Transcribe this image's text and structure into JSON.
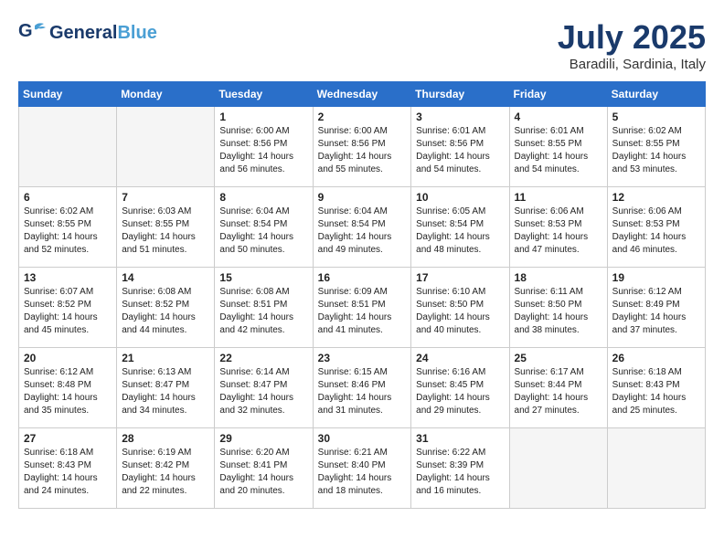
{
  "header": {
    "logo_general": "General",
    "logo_blue": "Blue",
    "month_year": "July 2025",
    "location": "Baradili, Sardinia, Italy"
  },
  "days_of_week": [
    "Sunday",
    "Monday",
    "Tuesday",
    "Wednesday",
    "Thursday",
    "Friday",
    "Saturday"
  ],
  "weeks": [
    [
      {
        "day": "",
        "info": ""
      },
      {
        "day": "",
        "info": ""
      },
      {
        "day": "1",
        "info": "Sunrise: 6:00 AM\nSunset: 8:56 PM\nDaylight: 14 hours\nand 56 minutes."
      },
      {
        "day": "2",
        "info": "Sunrise: 6:00 AM\nSunset: 8:56 PM\nDaylight: 14 hours\nand 55 minutes."
      },
      {
        "day": "3",
        "info": "Sunrise: 6:01 AM\nSunset: 8:56 PM\nDaylight: 14 hours\nand 54 minutes."
      },
      {
        "day": "4",
        "info": "Sunrise: 6:01 AM\nSunset: 8:55 PM\nDaylight: 14 hours\nand 54 minutes."
      },
      {
        "day": "5",
        "info": "Sunrise: 6:02 AM\nSunset: 8:55 PM\nDaylight: 14 hours\nand 53 minutes."
      }
    ],
    [
      {
        "day": "6",
        "info": "Sunrise: 6:02 AM\nSunset: 8:55 PM\nDaylight: 14 hours\nand 52 minutes."
      },
      {
        "day": "7",
        "info": "Sunrise: 6:03 AM\nSunset: 8:55 PM\nDaylight: 14 hours\nand 51 minutes."
      },
      {
        "day": "8",
        "info": "Sunrise: 6:04 AM\nSunset: 8:54 PM\nDaylight: 14 hours\nand 50 minutes."
      },
      {
        "day": "9",
        "info": "Sunrise: 6:04 AM\nSunset: 8:54 PM\nDaylight: 14 hours\nand 49 minutes."
      },
      {
        "day": "10",
        "info": "Sunrise: 6:05 AM\nSunset: 8:54 PM\nDaylight: 14 hours\nand 48 minutes."
      },
      {
        "day": "11",
        "info": "Sunrise: 6:06 AM\nSunset: 8:53 PM\nDaylight: 14 hours\nand 47 minutes."
      },
      {
        "day": "12",
        "info": "Sunrise: 6:06 AM\nSunset: 8:53 PM\nDaylight: 14 hours\nand 46 minutes."
      }
    ],
    [
      {
        "day": "13",
        "info": "Sunrise: 6:07 AM\nSunset: 8:52 PM\nDaylight: 14 hours\nand 45 minutes."
      },
      {
        "day": "14",
        "info": "Sunrise: 6:08 AM\nSunset: 8:52 PM\nDaylight: 14 hours\nand 44 minutes."
      },
      {
        "day": "15",
        "info": "Sunrise: 6:08 AM\nSunset: 8:51 PM\nDaylight: 14 hours\nand 42 minutes."
      },
      {
        "day": "16",
        "info": "Sunrise: 6:09 AM\nSunset: 8:51 PM\nDaylight: 14 hours\nand 41 minutes."
      },
      {
        "day": "17",
        "info": "Sunrise: 6:10 AM\nSunset: 8:50 PM\nDaylight: 14 hours\nand 40 minutes."
      },
      {
        "day": "18",
        "info": "Sunrise: 6:11 AM\nSunset: 8:50 PM\nDaylight: 14 hours\nand 38 minutes."
      },
      {
        "day": "19",
        "info": "Sunrise: 6:12 AM\nSunset: 8:49 PM\nDaylight: 14 hours\nand 37 minutes."
      }
    ],
    [
      {
        "day": "20",
        "info": "Sunrise: 6:12 AM\nSunset: 8:48 PM\nDaylight: 14 hours\nand 35 minutes."
      },
      {
        "day": "21",
        "info": "Sunrise: 6:13 AM\nSunset: 8:47 PM\nDaylight: 14 hours\nand 34 minutes."
      },
      {
        "day": "22",
        "info": "Sunrise: 6:14 AM\nSunset: 8:47 PM\nDaylight: 14 hours\nand 32 minutes."
      },
      {
        "day": "23",
        "info": "Sunrise: 6:15 AM\nSunset: 8:46 PM\nDaylight: 14 hours\nand 31 minutes."
      },
      {
        "day": "24",
        "info": "Sunrise: 6:16 AM\nSunset: 8:45 PM\nDaylight: 14 hours\nand 29 minutes."
      },
      {
        "day": "25",
        "info": "Sunrise: 6:17 AM\nSunset: 8:44 PM\nDaylight: 14 hours\nand 27 minutes."
      },
      {
        "day": "26",
        "info": "Sunrise: 6:18 AM\nSunset: 8:43 PM\nDaylight: 14 hours\nand 25 minutes."
      }
    ],
    [
      {
        "day": "27",
        "info": "Sunrise: 6:18 AM\nSunset: 8:43 PM\nDaylight: 14 hours\nand 24 minutes."
      },
      {
        "day": "28",
        "info": "Sunrise: 6:19 AM\nSunset: 8:42 PM\nDaylight: 14 hours\nand 22 minutes."
      },
      {
        "day": "29",
        "info": "Sunrise: 6:20 AM\nSunset: 8:41 PM\nDaylight: 14 hours\nand 20 minutes."
      },
      {
        "day": "30",
        "info": "Sunrise: 6:21 AM\nSunset: 8:40 PM\nDaylight: 14 hours\nand 18 minutes."
      },
      {
        "day": "31",
        "info": "Sunrise: 6:22 AM\nSunset: 8:39 PM\nDaylight: 14 hours\nand 16 minutes."
      },
      {
        "day": "",
        "info": ""
      },
      {
        "day": "",
        "info": ""
      }
    ]
  ]
}
